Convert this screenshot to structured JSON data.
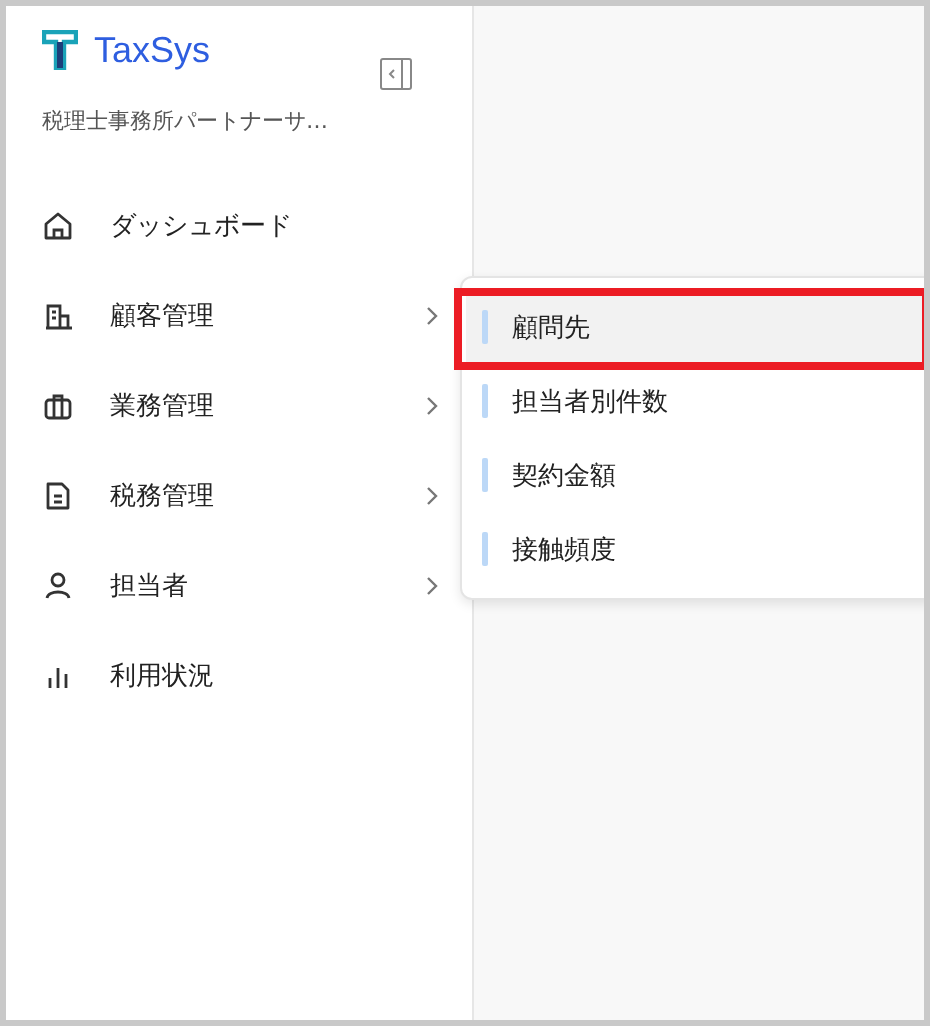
{
  "app": {
    "name": "TaxSys",
    "office": "税理士事務所パートナーサ…"
  },
  "nav_items": [
    {
      "label": "ダッシュボード",
      "has_submenu": false
    },
    {
      "label": "顧客管理",
      "has_submenu": true
    },
    {
      "label": "業務管理",
      "has_submenu": true
    },
    {
      "label": "税務管理",
      "has_submenu": true
    },
    {
      "label": "担当者",
      "has_submenu": true
    },
    {
      "label": "利用状況",
      "has_submenu": false
    }
  ],
  "submenu": {
    "items": [
      {
        "label": "顧問先",
        "selected": true,
        "highlighted": true
      },
      {
        "label": "担当者別件数",
        "selected": false,
        "highlighted": false
      },
      {
        "label": "契約金額",
        "selected": false,
        "highlighted": false
      },
      {
        "label": "接触頻度",
        "selected": false,
        "highlighted": false
      }
    ]
  }
}
